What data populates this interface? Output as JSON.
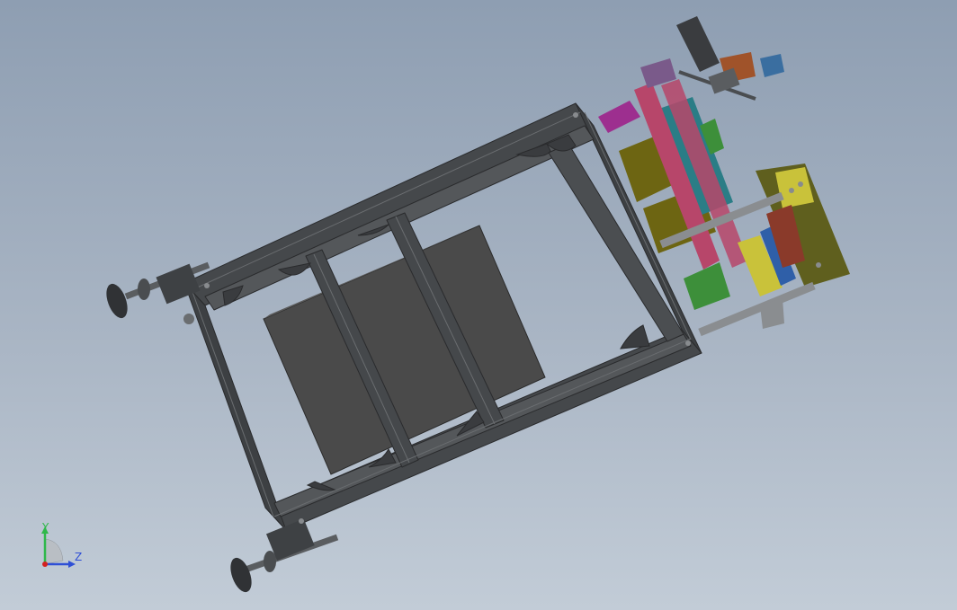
{
  "viewport": {
    "background_top": "#8e9eb2",
    "background_bottom": "#c2ccd7"
  },
  "model": {
    "frame_color": "#3d3f42",
    "plate_color": "#4a4a4a",
    "accent_colors": [
      "#9d2f8f",
      "#6d6512",
      "#2a7d86",
      "#3d8f3a",
      "#b7466a",
      "#5f5f1e",
      "#2f5fa8"
    ]
  },
  "triad": {
    "y_label": "Y",
    "z_label": "Z",
    "y_color": "#2fb84a",
    "z_color": "#2f4fd6",
    "origin_color": "#d42020"
  }
}
